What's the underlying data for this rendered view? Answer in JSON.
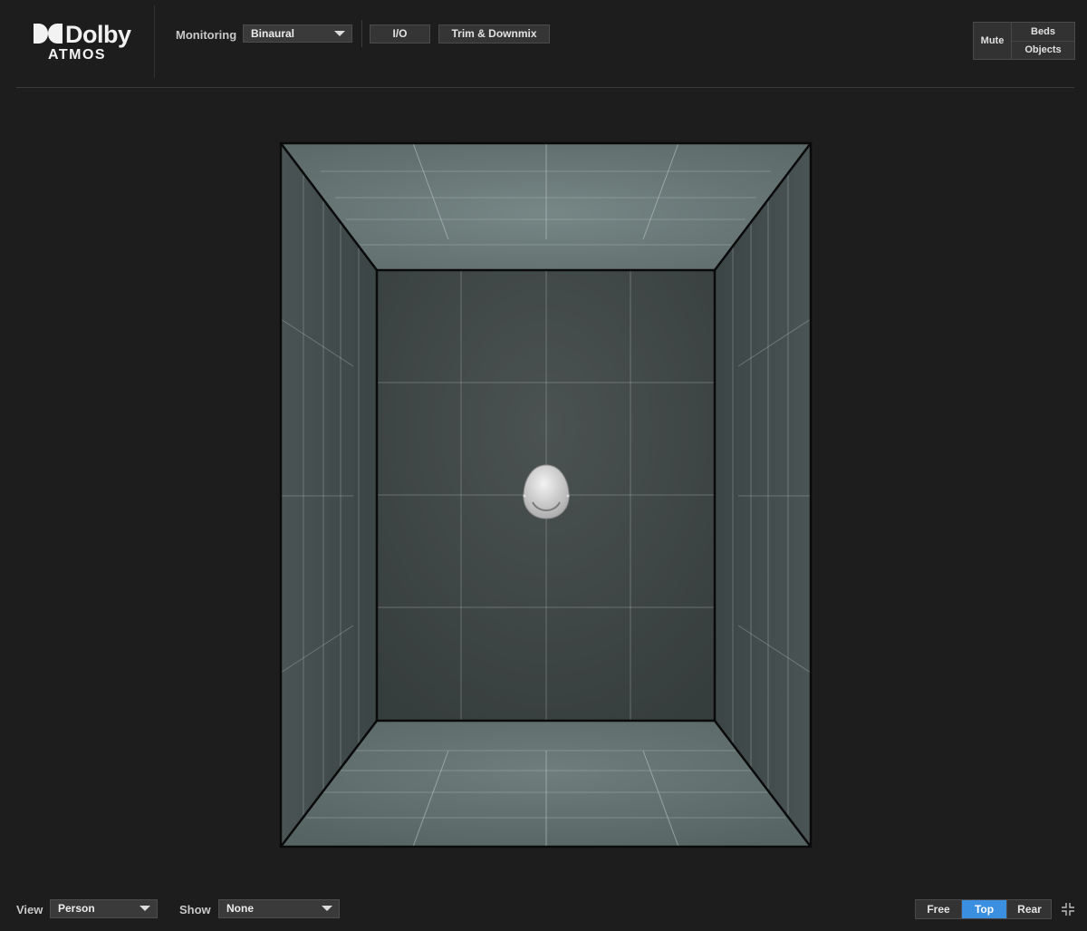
{
  "header": {
    "logo": {
      "brand": "Dolby",
      "product": "ATMOS"
    },
    "monitoring_label": "Monitoring",
    "monitoring_value": "Binaural",
    "io_button": "I/O",
    "trim_button": "Trim & Downmix",
    "mute": {
      "label": "Mute",
      "options": [
        "Beds",
        "Objects"
      ]
    }
  },
  "footer": {
    "view_label": "View",
    "view_value": "Person",
    "show_label": "Show",
    "show_value": "None",
    "camera_options": [
      "Free",
      "Top",
      "Rear"
    ],
    "camera_selected": "Top"
  },
  "icons": {
    "logo": "dolby-double-d-icon",
    "dropdown": "caret-down-icon",
    "listener": "listener-head-icon",
    "collapse": "collapse-arrows-icon"
  },
  "colors": {
    "background": "#1d1d1d",
    "accent_selected": "#3a8fe0",
    "room_wall": "#4a5252",
    "room_back": "#3f4646"
  }
}
